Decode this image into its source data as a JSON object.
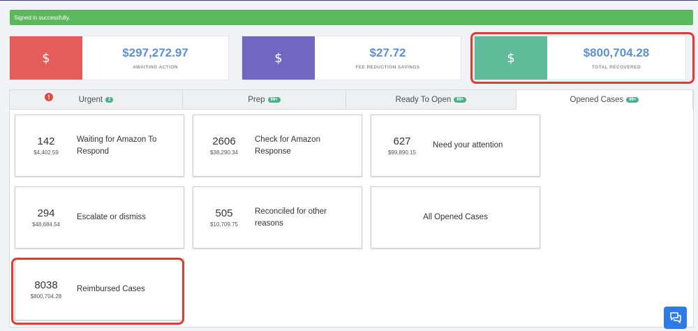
{
  "alert": {
    "text": "Signed in successfully."
  },
  "stats": [
    {
      "symbol": "$",
      "amount": "$297,272.97",
      "label": "AWAITING ACTION",
      "color": "#e35d5b"
    },
    {
      "symbol": "$",
      "amount": "$27.72",
      "label": "FEE REDUCTION SAVINGS",
      "color": "#7167c1"
    },
    {
      "symbol": "$",
      "amount": "$800,704.28",
      "label": "TOTAL RECOVERED",
      "color": "#5fbb9a"
    }
  ],
  "tabs": [
    {
      "label": "Urgent",
      "badge": "2",
      "warning": "!"
    },
    {
      "label": "Prep",
      "badge": "99+"
    },
    {
      "label": "Ready To Open",
      "badge": "99+"
    },
    {
      "label": "Opened Cases",
      "badge": "99+",
      "active": true
    }
  ],
  "cards": [
    {
      "count": "142",
      "sum": "$4,402.59",
      "title": "Waiting for Amazon To Respond"
    },
    {
      "count": "2606",
      "sum": "$38,290.34",
      "title": "Check for Amazon Response"
    },
    {
      "count": "627",
      "sum": "$99,890.15",
      "title": "Need your attention"
    },
    {
      "count": "294",
      "sum": "$48,684.54",
      "title": "Escalate or dismiss"
    },
    {
      "count": "505",
      "sum": "$10,709.75",
      "title": "Reconciled for other reasons"
    },
    {
      "title": "All Opened Cases"
    },
    {
      "count": "8038",
      "sum": "$800,704.28",
      "title": "Reimbursed Cases"
    }
  ],
  "colors": {
    "highlight": "#e03b2f",
    "success": "#5cb85c",
    "accent": "#5b8fd6",
    "chat": "#2f7be5"
  },
  "icons": {
    "chat": "chat-bubbles-icon",
    "warning": "exclamation-icon"
  }
}
